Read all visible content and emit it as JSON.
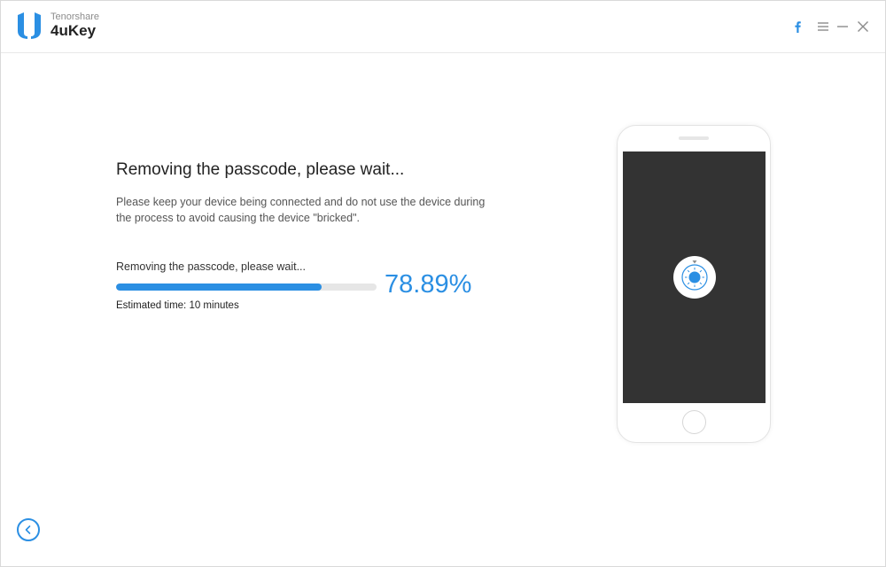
{
  "app": {
    "vendor": "Tenorshare",
    "name": "4uKey",
    "brand_color": "#2b8fe3"
  },
  "titlebar": {
    "icons": [
      "facebook-icon",
      "menu-icon",
      "minimize-icon",
      "close-icon"
    ]
  },
  "main": {
    "title": "Removing the passcode, please wait...",
    "description": "Please keep your device being connected and do not use the device during the process to avoid causing the device \"bricked\".",
    "progress": {
      "label": "Removing the passcode, please wait...",
      "percent_value": 78.89,
      "percent_text": "78.89%",
      "estimated_time": "Estimated time: 10 minutes"
    }
  },
  "device": {
    "screen_color": "#333333",
    "screen_icon": "unlock-progress-icon"
  },
  "footer": {
    "back_icon": "back-arrow-icon"
  }
}
